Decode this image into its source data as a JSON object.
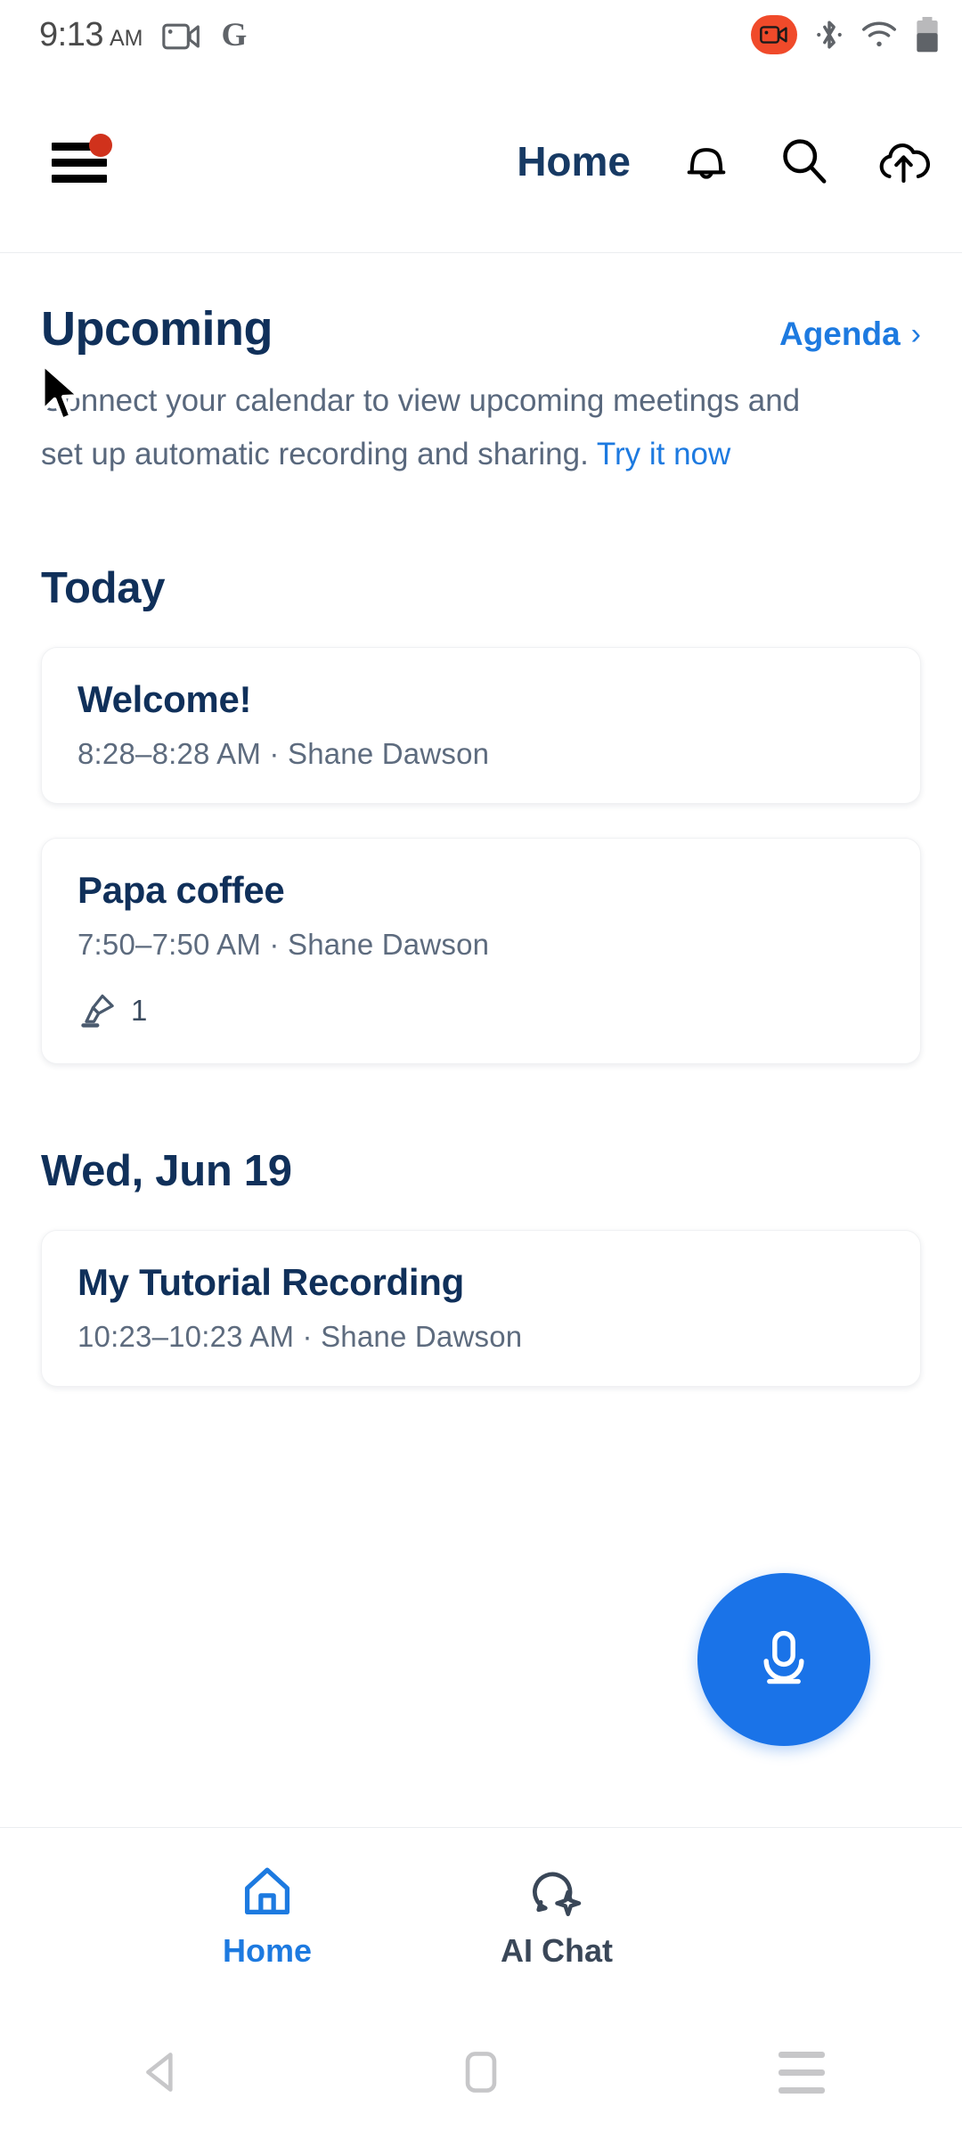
{
  "status_bar": {
    "time": "9:13",
    "ampm": "AM",
    "icons_left": [
      "video-call-icon",
      "google-g-icon"
    ],
    "google_letter": "G",
    "icons_right": [
      "screen-recording-badge",
      "bluetooth-icon",
      "wifi-icon",
      "battery-icon"
    ],
    "recording_color": "#F04A2A"
  },
  "app_bar": {
    "menu_icon": "hamburger-menu-icon",
    "menu_badge": true,
    "title": "Home",
    "icons": [
      "notifications-bell-icon",
      "search-icon",
      "cloud-upload-icon"
    ]
  },
  "upcoming": {
    "heading": "Upcoming",
    "link_label": "Agenda",
    "link_chevron": "›",
    "description_before": "Connect your calendar to view upcoming meetings and set up automatic recording and sharing.",
    "description_link": "Try it now"
  },
  "sections": [
    {
      "heading": "Today",
      "cards": [
        {
          "title": "Welcome!",
          "subtitle": "8:28–8:28 AM ·  Shane Dawson",
          "has_meta": false,
          "meta_icon": "",
          "meta_count": ""
        },
        {
          "title": "Papa coffee",
          "subtitle": "7:50–7:50 AM ·  Shane Dawson",
          "has_meta": true,
          "meta_icon": "highlighter-icon",
          "meta_count": "1"
        }
      ]
    },
    {
      "heading": "Wed, Jun 19",
      "cards": [
        {
          "title": "My Tutorial Recording",
          "subtitle": "10:23–10:23 AM ·  Shane Dawson",
          "has_meta": false,
          "meta_icon": "",
          "meta_count": ""
        }
      ]
    }
  ],
  "fab": {
    "icon": "microphone-icon",
    "color": "#1A73E8"
  },
  "bottom_nav": {
    "items": [
      {
        "label": "Home",
        "icon": "home-icon",
        "active": true
      },
      {
        "label": "AI Chat",
        "icon": "chat-sparkle-icon",
        "active": false
      }
    ],
    "active_color": "#1D7AE0",
    "inactive_color": "#3A4758"
  },
  "system_nav": {
    "back": "back-triangle-icon",
    "home": "home-square-icon",
    "recents": "recents-lines-icon"
  },
  "theme": {
    "accent_blue": "#1A73E8",
    "link_blue": "#1D7AE0",
    "navy": "#10305A",
    "muted_text": "#59687D",
    "badge_red": "#D0321C"
  }
}
